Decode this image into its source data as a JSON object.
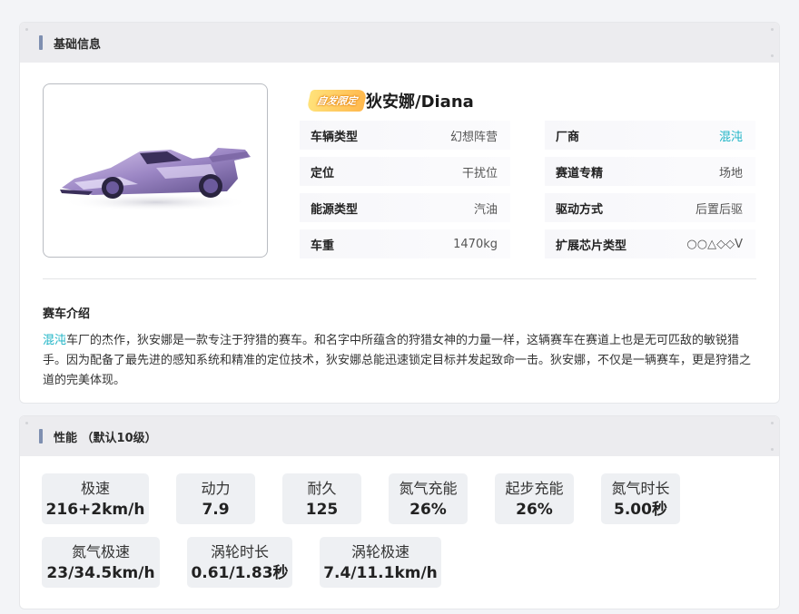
{
  "basic": {
    "section_title": "基础信息",
    "badge_text": "自发限定",
    "car_name": "狄安娜/Diana",
    "attributes_left": [
      {
        "label": "车辆类型",
        "value": "幻想阵营"
      },
      {
        "label": "定位",
        "value": "干扰位"
      },
      {
        "label": "能源类型",
        "value": "汽油"
      },
      {
        "label": "车重",
        "value": "1470kg"
      }
    ],
    "attributes_right": [
      {
        "label": "厂商",
        "value": "混沌"
      },
      {
        "label": "赛道专精",
        "value": "场地"
      },
      {
        "label": "驱动方式",
        "value": "后置后驱"
      },
      {
        "label": "扩展芯片类型",
        "value": "○○△◇◇V"
      }
    ],
    "intro_title": "赛车介绍",
    "intro_highlight": "混沌",
    "intro_text": "车厂的杰作，狄安娜是一款专注于狩猎的赛车。和名字中所蕴含的狩猎女神的力量一样，这辆赛车在赛道上也是无可匹敌的敏锐猎手。因为配备了最先进的感知系统和精准的定位技术，狄安娜总能迅速锁定目标并发起致命一击。狄安娜，不仅是一辆赛车，更是狩猎之道的完美体现。"
  },
  "performance": {
    "section_title": "性能 （默认10级）",
    "stats": [
      {
        "label": "极速",
        "value": "216+2km/h"
      },
      {
        "label": "动力",
        "value": "7.9"
      },
      {
        "label": "耐久",
        "value": "125"
      },
      {
        "label": "氮气充能",
        "value": "26%"
      },
      {
        "label": "起步充能",
        "value": "26%"
      },
      {
        "label": "氮气时长",
        "value": "5.00秒"
      },
      {
        "label": "氮气极速",
        "value": "23/34.5km/h"
      },
      {
        "label": "涡轮时长",
        "value": "0.61/1.83秒"
      },
      {
        "label": "涡轮极速",
        "value": "7.4/11.1km/h"
      }
    ]
  },
  "colors": {
    "accent_bar": "#7e8fb0",
    "link": "#1ab3c5",
    "header_bg": "#ececef",
    "stat_bg": "#eef0f3"
  }
}
